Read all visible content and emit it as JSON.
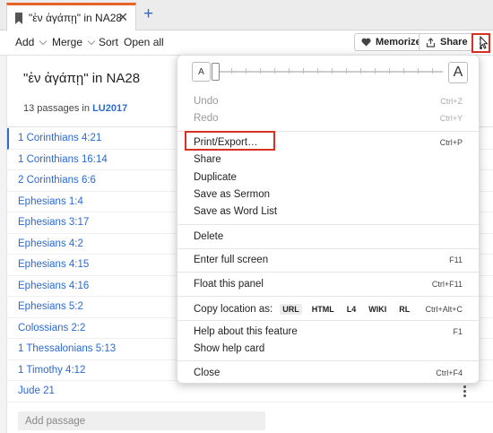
{
  "tab": {
    "title": "\"ἐν ἀγάπῃ\" in NA28",
    "close": "✕",
    "add": "+"
  },
  "toolbar": {
    "add": "Add",
    "merge": "Merge",
    "sort": "Sort",
    "open_all": "Open all",
    "memorize": "Memorize",
    "share": "Share"
  },
  "panel": {
    "title": "\"ἐν ἀγάπῃ\" in NA28",
    "count_text": "13 passages in ",
    "version": "LU2017",
    "passages": [
      "1 Corinthians 4:21",
      "1 Corinthians 16:14",
      "2 Corinthians 6:6",
      "Ephesians 1:4",
      "Ephesians 3:17",
      "Ephesians 4:2",
      "Ephesians 4:15",
      "Ephesians 4:16",
      "Ephesians 5:2",
      "Colossians 2:2",
      "1 Thessalonians 5:13",
      "1 Timothy 4:12",
      "Jude 21"
    ],
    "add_passage_placeholder": "Add passage"
  },
  "menu": {
    "zoom": {
      "small": "A",
      "large": "A",
      "level": 0
    },
    "undo": "Undo",
    "undo_sc": "Ctrl+Z",
    "redo": "Redo",
    "redo_sc": "Ctrl+Y",
    "print": "Print/Export…",
    "print_sc": "Ctrl+P",
    "share": "Share",
    "duplicate": "Duplicate",
    "save_sermon": "Save as Sermon",
    "save_wordlist": "Save as Word List",
    "delete": "Delete",
    "fullscreen": "Enter full screen",
    "fullscreen_sc": "F11",
    "float": "Float this panel",
    "float_sc": "Ctrl+F11",
    "copy_location": "Copy location as:",
    "copy_sc": "Ctrl+Alt+C",
    "formats": [
      "URL",
      "HTML",
      "L4",
      "WIKI",
      "RL"
    ],
    "help_feature": "Help about this feature",
    "help_sc": "F1",
    "help_card": "Show help card",
    "close": "Close",
    "close_sc": "Ctrl+F4"
  },
  "colors": {
    "accent": "#2a6ad1",
    "tab_accent": "#e8622c",
    "highlight": "#d93025"
  }
}
